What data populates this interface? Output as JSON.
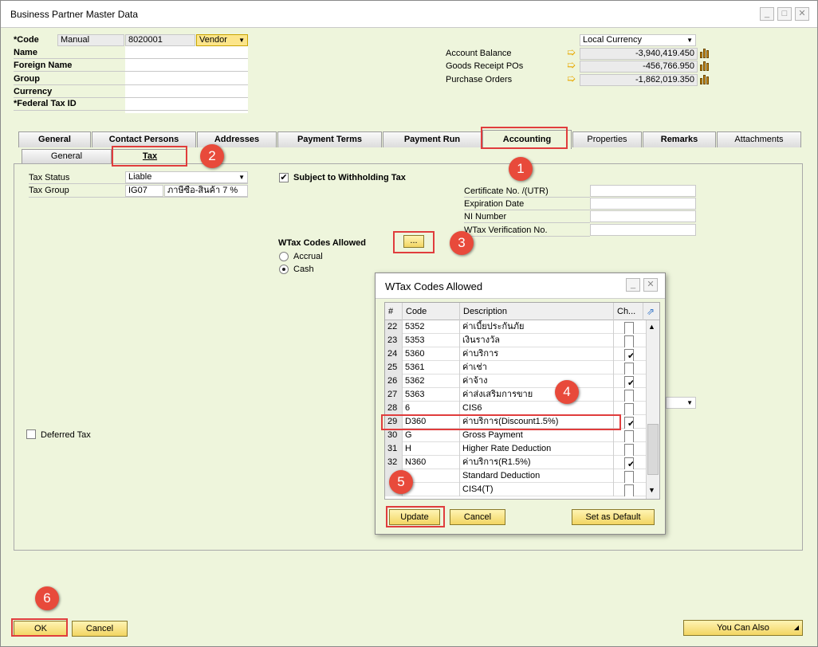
{
  "window": {
    "title": "Business Partner Master Data"
  },
  "header": {
    "code_label": "*Code",
    "code_series": "Manual",
    "code_value": "8020001",
    "bp_type": "Vendor",
    "name_label": "Name",
    "foreign_name_label": "Foreign Name",
    "group_label": "Group",
    "currency_label": "Currency",
    "federal_tax_label": "*Federal Tax ID",
    "currency_select": "Local Currency",
    "account_balance_label": "Account Balance",
    "account_balance_value": "-3,940,419.450",
    "goods_receipt_label": "Goods Receipt POs",
    "goods_receipt_value": "-456,766.950",
    "purchase_orders_label": "Purchase Orders",
    "purchase_orders_value": "-1,862,019.350"
  },
  "tabs": [
    "General",
    "Contact Persons",
    "Addresses",
    "Payment Terms",
    "Payment Run",
    "Accounting",
    "Properties",
    "Remarks",
    "Attachments"
  ],
  "subtabs": [
    "General",
    "Tax"
  ],
  "tax": {
    "tax_status_label": "Tax Status",
    "tax_status_value": "Liable",
    "tax_group_label": "Tax Group",
    "tax_group_code": "IG07",
    "tax_group_desc": "ภาษีซื้อ-สินค้า 7 %",
    "subject_wt_label": "Subject to Withholding Tax",
    "certificate_label": "Certificate No. /(UTR)",
    "expiration_label": "Expiration Date",
    "ni_number_label": "NI Number",
    "wtax_verification_label": "WTax Verification No.",
    "wtax_codes_allowed_label": "WTax Codes Allowed",
    "ellipsis": "...",
    "accrual_label": "Accrual",
    "cash_label": "Cash",
    "deferred_tax_label": "Deferred Tax"
  },
  "dialog": {
    "title": "WTax Codes Allowed",
    "columns": [
      "#",
      "Code",
      "Description",
      "Ch..."
    ],
    "rows": [
      {
        "num": "22",
        "code": "5352",
        "desc": "ค่าเบี้ยประกันภัย",
        "checked": false
      },
      {
        "num": "23",
        "code": "5353",
        "desc": "เงินรางวัล",
        "checked": false
      },
      {
        "num": "24",
        "code": "5360",
        "desc": "ค่าบริการ",
        "checked": true
      },
      {
        "num": "25",
        "code": "5361",
        "desc": "ค่าเช่า",
        "checked": false
      },
      {
        "num": "26",
        "code": "5362",
        "desc": "ค่าจ้าง",
        "checked": true
      },
      {
        "num": "27",
        "code": "5363",
        "desc": "ค่าส่งเสริมการขาย",
        "checked": false
      },
      {
        "num": "28",
        "code": "6",
        "desc": "CIS6",
        "checked": false
      },
      {
        "num": "29",
        "code": "D360",
        "desc": "ค่าบริการ(Discount1.5%)",
        "checked": true
      },
      {
        "num": "30",
        "code": "G",
        "desc": "Gross Payment",
        "checked": false
      },
      {
        "num": "31",
        "code": "H",
        "desc": "Higher Rate Deduction",
        "checked": false
      },
      {
        "num": "32",
        "code": "N360",
        "desc": "ค่าบริการ(R1.5%)",
        "checked": true
      },
      {
        "num": "",
        "code": "",
        "desc": "Standard Deduction",
        "checked": false
      },
      {
        "num": "",
        "code": "",
        "desc": "CIS4(T)",
        "checked": false
      }
    ],
    "update_label": "Update",
    "cancel_label": "Cancel",
    "default_label": "Set as Default"
  },
  "footer": {
    "ok_label": "OK",
    "cancel_label": "Cancel",
    "you_can_also_label": "You Can Also"
  },
  "annotations": [
    "1",
    "2",
    "3",
    "4",
    "5",
    "6"
  ]
}
